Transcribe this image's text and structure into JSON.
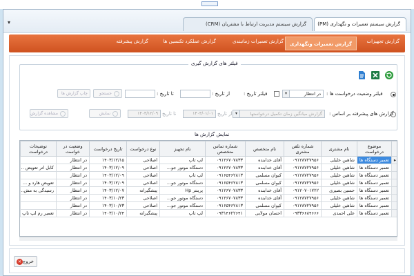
{
  "window": {
    "tabs": [
      {
        "label": "گزارش سیستم تعمیرات و نگهداری (PM)"
      },
      {
        "label": "گزارش سیستم مدیریت ارتباط با مشتریان (CRM)"
      }
    ],
    "system_menu_glyph": "▾"
  },
  "menu": {
    "items": [
      {
        "label": "گزارش تجهیزات"
      },
      {
        "label": "گزارش تعمیرات ونگهداری",
        "active": true
      },
      {
        "label": "گزارش تعمیرات زمانبندی"
      },
      {
        "label": "گزارش عملکرد تکنسین ها"
      },
      {
        "label": "گزارش پیشرفته"
      }
    ]
  },
  "filters": {
    "title": "فیلتر های گزارش گیری",
    "row1": {
      "radio_label": "فیلتر وضعیت درخواست ها :",
      "status_value": "در انتظار",
      "date_filter_label": "فیلتر تاریخ :",
      "from_label": "از تاریخ :",
      "to_label": "تا تاریخ :",
      "search_button": "جستجو",
      "print_button": "چاپ گزارش ها"
    },
    "row2": {
      "radio_label": "گزارش های پیشرفته بر اساس :",
      "basis_placeholder": "گزارش میانگین زمان تکمیل درخواستها",
      "from_label": "از تاریخ",
      "from_value": "۱۴۰۳/۰۱/۰۱",
      "to_label": "تا تاریخ",
      "to_value": "۱۴۰۳/۱۲/۰۹",
      "show_button": "نمایش",
      "view_report_button": "مشاهده گزارش"
    }
  },
  "results": {
    "title": "نمایش گزارش ها",
    "columns": [
      "موضوع درخواست",
      "نام مشتری",
      "شماره تلفن مشتری",
      "نام متخصص",
      "شماره تماس متخصص",
      "نام تجهیز",
      "نوع درخواست",
      "تاریخ درخواست",
      "وضعیت در خواست",
      "توضیحات درخواست"
    ],
    "rows": [
      [
        "تعمیر دستگاه ها",
        "شاهین خلیلی",
        "۰۹۱۲۸۷۲۷۹۵۶",
        "آقای خدابنده",
        "۰۹۱۲۶۷۰۷۸۳۳",
        "لپ تاپ",
        "اصلاحی",
        "۱۴۰۳/۱۲/۱۵",
        "در انتظار",
        ""
      ],
      [
        "تعمیر دستگاه ها",
        "شاهین خلیلی",
        "۰۹۱۲۸۷۲۷۹۵۶",
        "آقای خدابنده",
        "۰۹۱۲۶۷۰۷۸۳۳",
        "دستگاه موتور جو...",
        "اصلاحی",
        "۱۴۰۳/۱۲/۰۹",
        "در انتظار",
        "کابل اتر تعویض ..."
      ],
      [
        "تعمیر دستگاه ها",
        "شاهین خلیلی",
        "۰۹۱۲۸۷۲۷۹۵۶",
        "کیوان مسلمی",
        "۰۹۱۶۵۴۶۲۸۱۳",
        "لپ تاپ",
        "اصلاحی",
        "۱۴۰۳/۱۲/۰۹",
        "در انتظار",
        ""
      ],
      [
        "تعمیر دستگاه ها",
        "شاهین خلیلی",
        "۰۹۱۲۸۷۲۷۹۵۶",
        "کیوان مسلمی",
        "۰۹۱۶۵۴۶۲۸۱۳",
        "دستگاه موتور جو...",
        "اصلاحی",
        "۱۴۰۳/۱۲/۰۹",
        "در انتظار",
        "تعویض هارد و ..."
      ],
      [
        "تعمیر دستگاه ها",
        "حسین بصیری",
        "۰۹۱۲۰۷۰۱۷۲۲",
        "آقای خدابنده",
        "۰۹۱۲۶۷۰۷۸۳۳",
        "پرینتر Hp",
        "پیشگیرانه",
        "۱۴۰۳/۱۲/۰۷",
        "در انتظار",
        "رسیدگی به مش..."
      ],
      [
        "تعمیر دستگاه ها",
        "شاهین خلیلی",
        "۰۹۱۲۸۷۲۷۹۵۶",
        "آقای خدابنده",
        "۰۹۱۲۶۷۰۷۸۳۳",
        "دستگاه موتور جو...",
        "اصلاحی",
        "۱۴۰۳/۱۰/۲۳",
        "در انتظار",
        ""
      ],
      [
        "تعمیر دستگاه ها",
        "شاهین خلیلی",
        "۰۹۱۲۸۷۲۷۹۵۶",
        "کیوان مسلمی",
        "۰۹۱۶۵۴۶۲۸۱۳",
        "دستگاه موتور جو...",
        "اصلاحی",
        "۱۴۰۳/۱۰/۲۳",
        "در انتظار",
        ""
      ],
      [
        "تعمیر دستگاه ها",
        "علی احمدی",
        "۰۹۳۳۶۶۸۴۶۶۶",
        "احسان مولایی",
        "۰۹۳۱۴۶۲۲۶۴۱",
        "لپ تاپ",
        "پیشگیرانه",
        "۱۴۰۳/۱۰/۲۴",
        "در انتظار",
        "تعمیر رم لپ تاپ"
      ]
    ]
  },
  "footer": {
    "exit_button": "خروج"
  },
  "colors": {
    "menu_orange": "#d9602a",
    "selected_blue": "#3d8be0",
    "excel_green": "#1e7b45",
    "refresh_green": "#2a9a3a",
    "doc_blue": "#2f7fd1"
  }
}
